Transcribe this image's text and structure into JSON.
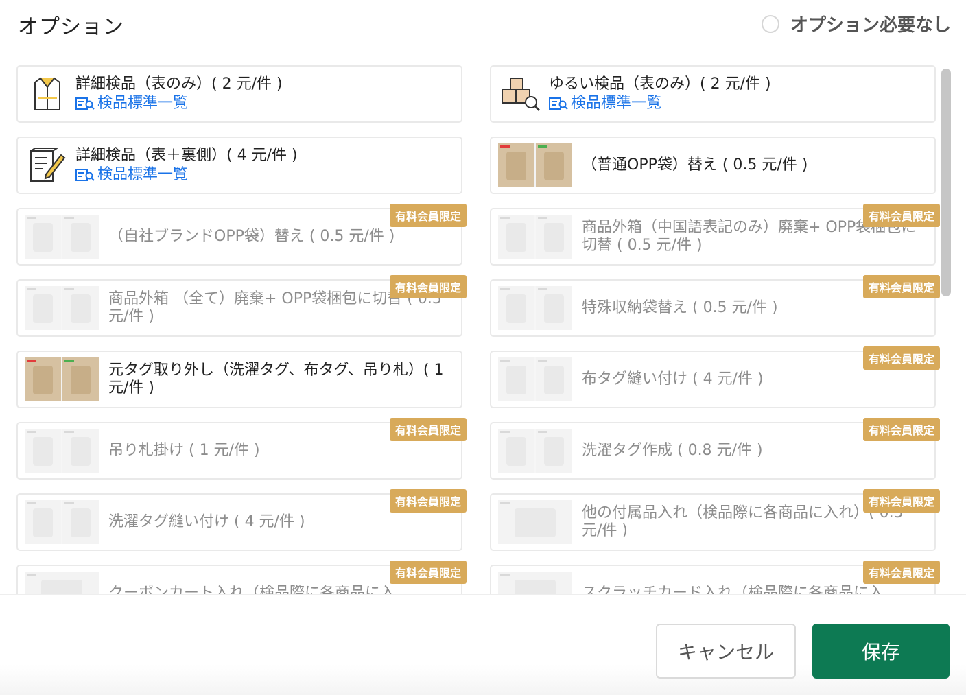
{
  "header": {
    "title": "オプション",
    "no_option_label": "オプション必要なし"
  },
  "colors": {
    "badge": "#d8aa5a",
    "link": "#1a73e8",
    "save": "#0d7a53"
  },
  "badge_label": "有料会員限定",
  "link_label": "検品標準一覧",
  "options": [
    {
      "label": "詳細検品（表のみ）( 2 元/件 )",
      "note": "検品標準一覧",
      "icon": "jacket-inspection-icon",
      "locked": false
    },
    {
      "label": "ゆるい検品（表のみ）( 2 元/件 )",
      "note": "検品標準一覧",
      "icon": "boxes-search-icon",
      "locked": false
    },
    {
      "label": "詳細検品（表＋裏側）( 4 元/件 )",
      "note": "検品標準一覧",
      "icon": "checklist-pen-icon",
      "locked": false
    },
    {
      "label": "（普通OPP袋）替え ( 0.5 元/件 )",
      "locked": false
    },
    {
      "label": "（自社ブランドOPP袋）替え ( 0.5 元/件 )",
      "locked": true
    },
    {
      "label": "商品外箱（中国語表記のみ）廃棄+ OPP袋梱包に切替 ( 0.5 元/件 )",
      "locked": true
    },
    {
      "label": "商品外箱 （全て）廃棄+ OPP袋梱包に切替 ( 0.5 元/件 )",
      "locked": true
    },
    {
      "label": "特殊収納袋替え ( 0.5 元/件 )",
      "locked": true
    },
    {
      "label": "元タグ取り外し（洗濯タグ、布タグ、吊り札）( 1 元/件 )",
      "locked": false
    },
    {
      "label": "布タグ縫い付け ( 4 元/件 )",
      "locked": true
    },
    {
      "label": "吊り札掛け ( 1 元/件 )",
      "locked": true
    },
    {
      "label": "洗濯タグ作成 ( 0.8 元/件 )",
      "locked": true
    },
    {
      "label": "洗濯タグ縫い付け ( 4 元/件 )",
      "locked": true
    },
    {
      "label": "他の付属品入れ（検品際に各商品に入れ）( 0.5 元/件 )",
      "locked": true
    },
    {
      "label": "クーポンカート入れ（検品際に各商品に入",
      "locked": true
    },
    {
      "label": "スクラッチカード入れ（検品際に各商品に入",
      "locked": true
    }
  ],
  "footer": {
    "cancel_label": "キャンセル",
    "save_label": "保存"
  }
}
